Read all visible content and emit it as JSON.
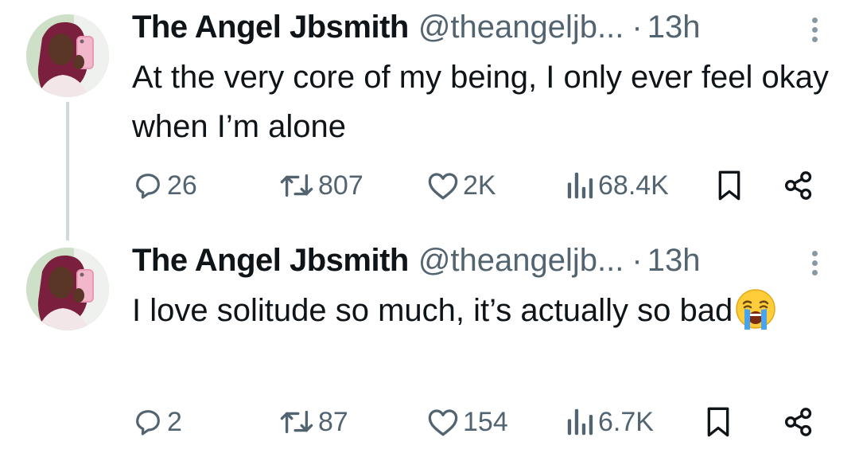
{
  "tweets": [
    {
      "name": "The Angel Jbsmith",
      "handle": "@theangeljb...",
      "separator": "·",
      "time": "13h",
      "text": "At the very core of my being, I only ever feel okay when I’m alone",
      "emoji": "",
      "replies": "26",
      "retweets": "807",
      "likes": "2K",
      "views": "68.4K"
    },
    {
      "name": "The Angel Jbsmith",
      "handle": "@theangeljb...",
      "separator": "·",
      "time": "13h",
      "text": "I love solitude so much, it’s actually so bad",
      "emoji": "loudly-crying-face",
      "replies": "2",
      "retweets": "87",
      "likes": "154",
      "views": "6.7K"
    }
  ],
  "icons": {
    "reply": "speech-bubble-icon",
    "retweet": "retweet-icon",
    "like": "heart-icon",
    "views": "bar-chart-icon",
    "bookmark": "bookmark-icon",
    "share": "share-icon",
    "more": "more-vertical-icon"
  },
  "colors": {
    "text": "#0f1419",
    "secondary": "#536471",
    "thread_line": "#cfd9de"
  }
}
